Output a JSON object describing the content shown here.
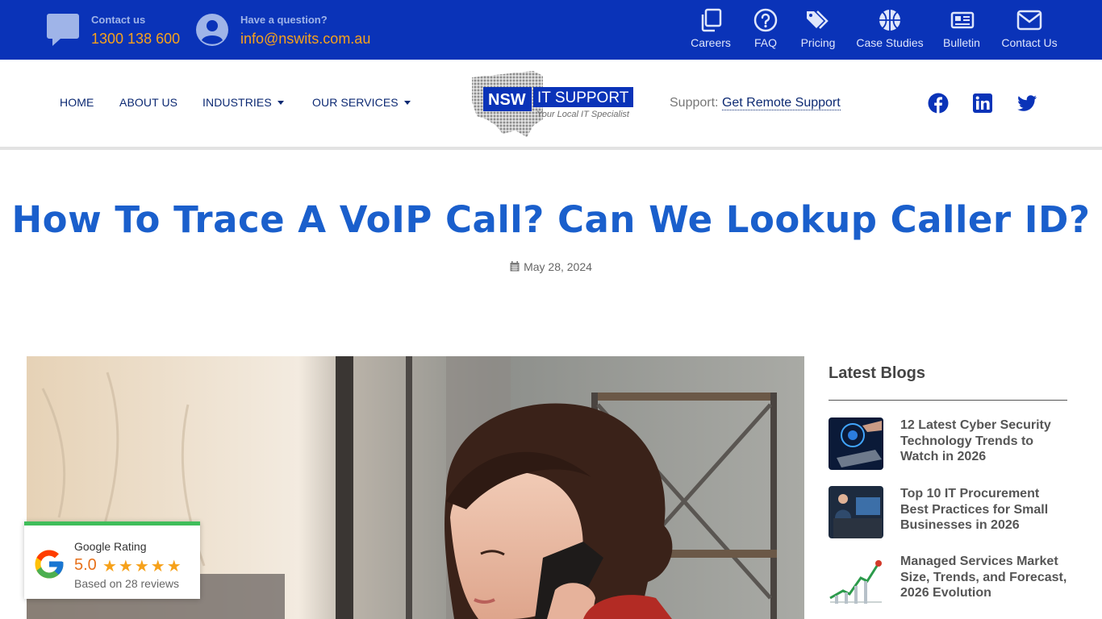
{
  "topbar": {
    "contact": {
      "label": "Contact us",
      "phone": "1300 138 600"
    },
    "question": {
      "label": "Have a question?",
      "email": "info@nswits.com.au"
    },
    "links": [
      {
        "label": "Careers",
        "icon": "copy-icon"
      },
      {
        "label": "FAQ",
        "icon": "question-icon"
      },
      {
        "label": "Pricing",
        "icon": "tags-icon"
      },
      {
        "label": "Case Studies",
        "icon": "basketball-icon"
      },
      {
        "label": "Bulletin",
        "icon": "newspaper-icon"
      },
      {
        "label": "Contact Us",
        "icon": "envelope-icon"
      }
    ]
  },
  "nav": {
    "items": [
      {
        "label": "HOME"
      },
      {
        "label": "ABOUT US"
      },
      {
        "label": "INDUSTRIES"
      },
      {
        "label": "OUR SERVICES"
      }
    ],
    "logo": {
      "brand": "NSW",
      "name": "IT SUPPORT",
      "tagline": "Your Local IT Specialist"
    },
    "support_label": "Support:",
    "support_link": "Get Remote Support",
    "social": [
      "facebook-icon",
      "linkedin-icon",
      "twitter-icon"
    ]
  },
  "post": {
    "title": "How To Trace A VoIP Call? Can We Lookup Caller ID?",
    "date": "May 28, 2024"
  },
  "sidebar": {
    "title": "Latest Blogs",
    "items": [
      {
        "title": "12 Latest Cyber Security Technology Trends to Watch in 2026"
      },
      {
        "title": "Top 10 IT Procurement Best Practices for Small Businesses in 2026"
      },
      {
        "title": "Managed Services Market Size, Trends, and Forecast, 2026 Evolution"
      }
    ]
  },
  "rating": {
    "label": "Google Rating",
    "score": "5.0",
    "stars": 5,
    "reviews": "Based on 28 reviews"
  },
  "colors": {
    "topbar": "#0a33b8",
    "accent_orange": "#f7a21b",
    "title_blue": "#1a5fcc",
    "nav_text": "#0d2a73",
    "rating_green": "#3fbd5a"
  }
}
